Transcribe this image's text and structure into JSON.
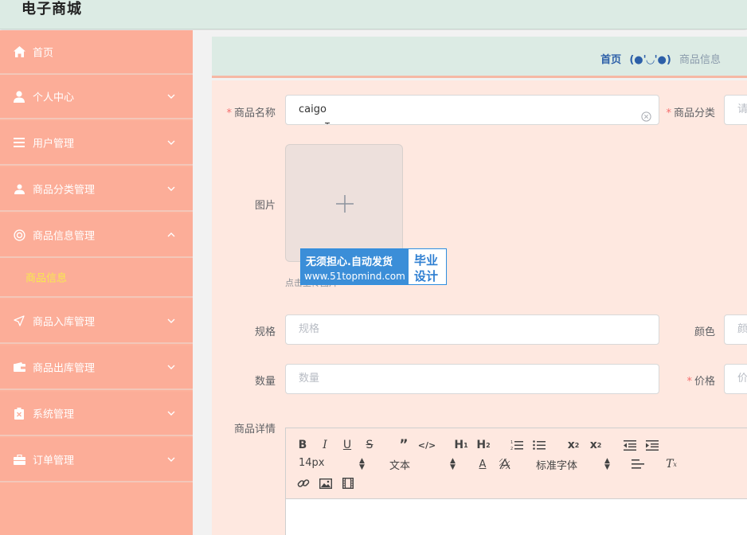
{
  "header": {
    "title": "电子商城"
  },
  "sidebar": {
    "items": [
      {
        "label": "首页",
        "icon": "home-icon"
      },
      {
        "label": "个人中心",
        "icon": "user-icon"
      },
      {
        "label": "用户管理",
        "icon": "list-icon"
      },
      {
        "label": "商品分类管理",
        "icon": "user-icon"
      },
      {
        "label": "商品信息管理",
        "icon": "lifebuoy-icon"
      },
      {
        "label": "商品入库管理",
        "icon": "send-icon"
      },
      {
        "label": "商品出库管理",
        "icon": "wallet-icon"
      },
      {
        "label": "系统管理",
        "icon": "clipboard-icon"
      },
      {
        "label": "订单管理",
        "icon": "briefcase-icon"
      }
    ],
    "submenu": {
      "label": "商品信息"
    }
  },
  "breadcrumb": {
    "home": "首页",
    "separator": "(●'◡'●)",
    "current": "商品信息"
  },
  "form": {
    "name": {
      "label": "商品名称",
      "value": "caigo"
    },
    "category": {
      "label": "商品分类",
      "placeholder": "请"
    },
    "image": {
      "label": "图片",
      "tip": "点击上传图片"
    },
    "spec": {
      "label": "规格",
      "placeholder": "规格"
    },
    "color": {
      "label": "颜色",
      "placeholder": "颜"
    },
    "quantity": {
      "label": "数量",
      "placeholder": "数量"
    },
    "price": {
      "label": "价格",
      "placeholder": "价"
    },
    "detail": {
      "label": "商品详情"
    },
    "required_mark": "*"
  },
  "editor": {
    "font_size": "14px",
    "block_type": "文本",
    "font_family": "标准字体"
  },
  "watermark": {
    "line1": "无须担心.自动发货",
    "line2": "www.51topmind.com",
    "right1": "毕业",
    "right2": "设计"
  },
  "colors": {
    "sidebar": "#fcad98",
    "header": "#dcebe4",
    "form": "#fee8e0",
    "required": "#f56c6c",
    "active_sub": "#f7e94e"
  }
}
